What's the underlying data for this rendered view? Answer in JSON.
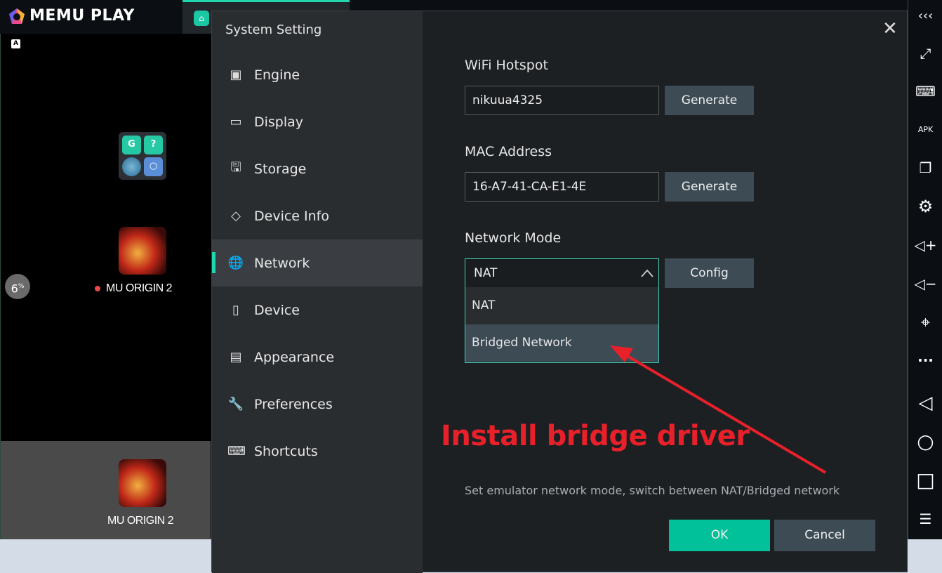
{
  "app": {
    "logo": "MEMU PLAY",
    "badge": "A",
    "progress_percent": 6,
    "progress_label": "6",
    "progress_unit": "%"
  },
  "desktop": {
    "folder_icons": [
      "G",
      "?",
      "◎",
      "○"
    ],
    "games": [
      {
        "name": "MU ORIGIN 2",
        "dot": true
      },
      {
        "name": "MU ORIGIN 2",
        "dot": false
      }
    ]
  },
  "toolbar": {
    "items": [
      "collapse-icon",
      "fullscreen-icon",
      "keyboard-icon",
      "apk-icon",
      "multi-window-icon",
      "settings-icon",
      "volume-up-icon",
      "volume-down-icon",
      "location-icon",
      "more-icon",
      "back-icon",
      "home-icon",
      "recents-icon",
      "menu-icon"
    ],
    "glyphs": [
      "‹‹‹",
      "⤢",
      "⌨",
      "APK",
      "❐",
      "⚙",
      "◁+",
      "◁−",
      "⌖",
      "···",
      "◁",
      "○",
      "□",
      "☰"
    ]
  },
  "dialog": {
    "title": "System Setting",
    "close": "✕",
    "sidebar": [
      {
        "label": "Engine",
        "icon": "cpu-icon",
        "glyph": "▣"
      },
      {
        "label": "Display",
        "icon": "monitor-icon",
        "glyph": "▭"
      },
      {
        "label": "Storage",
        "icon": "save-icon",
        "glyph": "🖫"
      },
      {
        "label": "Device Info",
        "icon": "tag-icon",
        "glyph": "◇"
      },
      {
        "label": "Network",
        "icon": "globe-icon",
        "glyph": "🌐",
        "active": true
      },
      {
        "label": "Device",
        "icon": "phone-icon",
        "glyph": "▯"
      },
      {
        "label": "Appearance",
        "icon": "window-icon",
        "glyph": "▤"
      },
      {
        "label": "Preferences",
        "icon": "wrench-icon",
        "glyph": "🔧"
      },
      {
        "label": "Shortcuts",
        "icon": "keyboard-icon",
        "glyph": "⌨"
      }
    ],
    "wifi": {
      "label": "WiFi Hotspot",
      "value": "nikuua4325",
      "button": "Generate"
    },
    "mac": {
      "label": "MAC Address",
      "value": "16-A7-41-CA-E1-4E",
      "button": "Generate"
    },
    "network": {
      "label": "Network Mode",
      "selected": "NAT",
      "options": [
        "NAT",
        "Bridged Network"
      ],
      "highlighted": "Bridged Network",
      "button": "Config"
    },
    "annotation": "Install bridge driver",
    "description": "Set emulator network mode, switch between NAT/Bridged network",
    "ok": "OK",
    "cancel": "Cancel"
  },
  "colors": {
    "accent": "#1fd6ae",
    "ok": "#00c19a",
    "annotation": "#e8202a"
  }
}
